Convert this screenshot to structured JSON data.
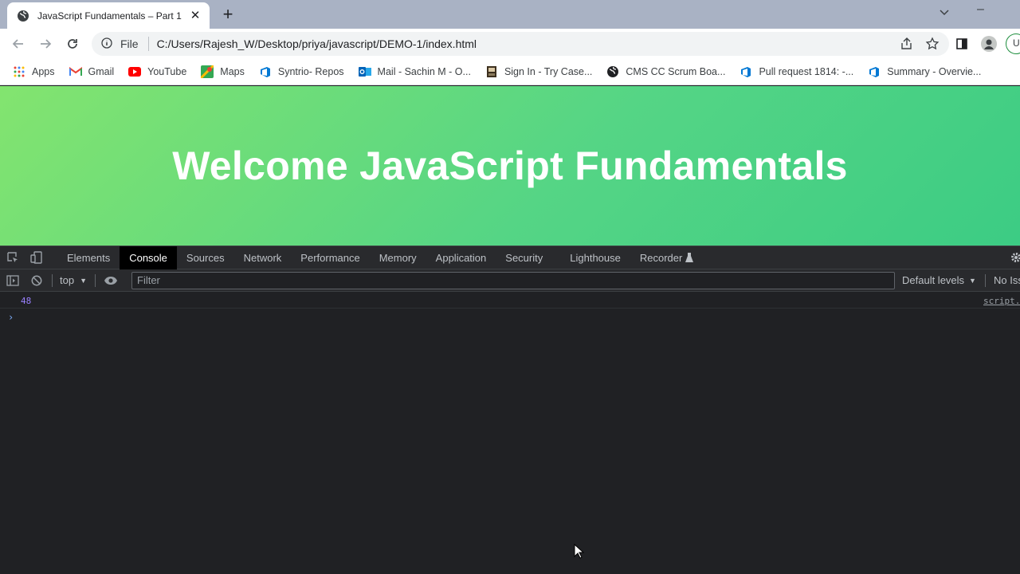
{
  "browser": {
    "tab_title": "JavaScript Fundamentals – Part 1",
    "new_tab_label": "+",
    "close_label": "✕",
    "url_scheme": "File",
    "url": "C:/Users/Rajesh_W/Desktop/priya/javascript/DEMO-1/index.html",
    "profile_partial": "U"
  },
  "bookmarks": [
    {
      "label": "Apps",
      "icon": "apps-grid-icon"
    },
    {
      "label": "Gmail",
      "icon": "gmail-icon"
    },
    {
      "label": "YouTube",
      "icon": "youtube-icon"
    },
    {
      "label": "Maps",
      "icon": "maps-icon"
    },
    {
      "label": "Syntrio- Repos",
      "icon": "azure-devops-icon"
    },
    {
      "label": "Mail - Sachin M - O...",
      "icon": "outlook-icon"
    },
    {
      "label": "Sign In - Try Case...",
      "icon": "casefile-icon"
    },
    {
      "label": "CMS CC Scrum Boa...",
      "icon": "globe-icon"
    },
    {
      "label": "Pull request 1814: -...",
      "icon": "azure-devops-icon"
    },
    {
      "label": "Summary - Overvie...",
      "icon": "azure-devops-icon"
    }
  ],
  "page": {
    "heading": "Welcome JavaScript Fundamentals"
  },
  "devtools": {
    "tabs": [
      "Elements",
      "Console",
      "Sources",
      "Network",
      "Performance",
      "Memory",
      "Application",
      "Security",
      "Lighthouse",
      "Recorder"
    ],
    "active_tab": "Console",
    "context": "top",
    "filter_placeholder": "Filter",
    "levels": "Default levels",
    "issues_partial": "No Iss",
    "console_output": [
      {
        "value": "48",
        "source": "script."
      }
    ],
    "prompt": "›"
  },
  "colors": {
    "gradient_start": "#83e46f",
    "gradient_end": "#3ccc84",
    "console_number": "#9980ff"
  }
}
